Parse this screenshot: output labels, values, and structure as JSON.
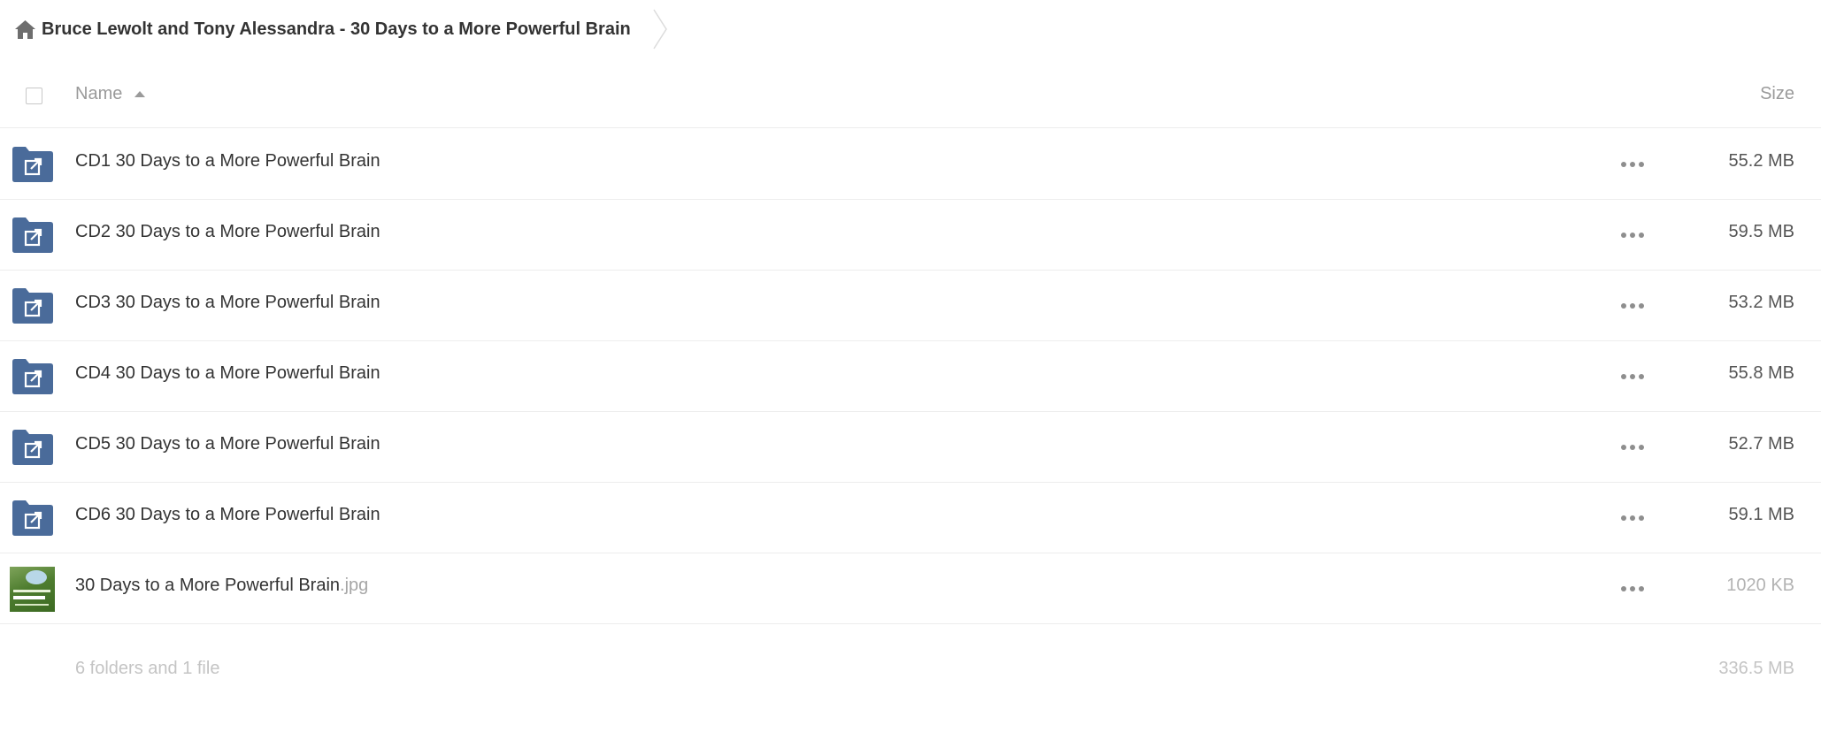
{
  "breadcrumb": {
    "home_icon": "home-icon",
    "current": "Bruce Lewolt and Tony Alessandra - 30 Days to a More Powerful Brain"
  },
  "header": {
    "name_label": "Name",
    "size_label": "Size",
    "sort_icon": "sort-ascending-icon"
  },
  "colors": {
    "folder": "#4a6b9a",
    "text": "#333333",
    "muted": "#9a9a9a"
  },
  "files": [
    {
      "name": "CD1 30 Days to a More Powerful Brain",
      "ext": "",
      "size": "55.2 MB",
      "type": "shared-folder"
    },
    {
      "name": "CD2 30 Days to a More Powerful Brain",
      "ext": "",
      "size": "59.5 MB",
      "type": "shared-folder"
    },
    {
      "name": "CD3 30 Days to a More Powerful Brain",
      "ext": "",
      "size": "53.2 MB",
      "type": "shared-folder"
    },
    {
      "name": "CD4 30 Days to a More Powerful Brain",
      "ext": "",
      "size": "55.8 MB",
      "type": "shared-folder"
    },
    {
      "name": "CD5 30 Days to a More Powerful Brain",
      "ext": "",
      "size": "52.7 MB",
      "type": "shared-folder"
    },
    {
      "name": "CD6 30 Days to a More Powerful Brain",
      "ext": "",
      "size": "59.1 MB",
      "type": "shared-folder"
    },
    {
      "name": "30 Days to a More Powerful Brain",
      "ext": ".jpg",
      "size": "1020 KB",
      "type": "image"
    }
  ],
  "summary": {
    "text": "6 folders and 1 file",
    "total": "336.5 MB"
  }
}
